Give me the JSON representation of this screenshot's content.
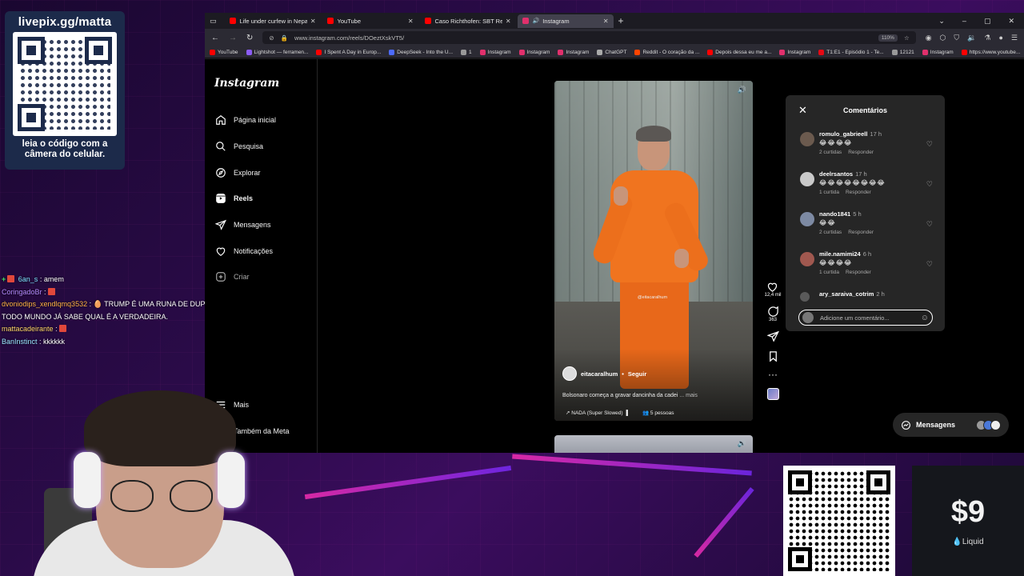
{
  "livepix": {
    "title": "livepix.gg/matta",
    "caption": "leia o código com a câmera do celular."
  },
  "chat": [
    {
      "user": "6an_s",
      "text": ": amem",
      "prefix": "+"
    },
    {
      "user": "CoringadoBr",
      "text": ":"
    },
    {
      "user": "dvoniodips_xendlqmq3532",
      "text": ": 🥚 TRUMP É UMA RUNA DE DUPLA ILUSÃO QUE",
      "cont": "TODO MUNDO JÁ SABE QUAL É A VERDADEIRA."
    },
    {
      "user": "mattacadeirante",
      "text": ":"
    },
    {
      "user": "BanInstinct",
      "text": ": kkkkkk"
    }
  ],
  "browser": {
    "tabs": [
      {
        "label": "Life under curfew in Nepal (Th",
        "color": "#ff0000"
      },
      {
        "label": "YouTube",
        "color": "#ff0000"
      },
      {
        "label": "Caso Richthofen: SBT Repórter",
        "color": "#ff0000"
      },
      {
        "label": "Instagram",
        "color": "#e1306c",
        "active": true
      }
    ],
    "url": "www.instagram.com/reels/DOeztXskVT5/",
    "zoom": "110%",
    "bookmarks": [
      {
        "label": "YouTube",
        "color": "#ff0000"
      },
      {
        "label": "Lightshot — ferramen...",
        "color": "#8b5cf6"
      },
      {
        "label": "I Spent A Day in Europ...",
        "color": "#ff0000"
      },
      {
        "label": "DeepSeek - Into the U...",
        "color": "#4d6bfe"
      },
      {
        "label": "1",
        "color": "#999999"
      },
      {
        "label": "Instagram",
        "color": "#e1306c"
      },
      {
        "label": "Instagram",
        "color": "#e1306c"
      },
      {
        "label": "Instagram",
        "color": "#e1306c"
      },
      {
        "label": "ChatGPT",
        "color": "#aaaaaa"
      },
      {
        "label": "Reddit - O coração da ...",
        "color": "#ff4500"
      },
      {
        "label": "Depois dessa eu me a...",
        "color": "#ff0000"
      },
      {
        "label": "Instagram",
        "color": "#e1306c"
      },
      {
        "label": "T1:E1 - Episódio 1 - Te...",
        "color": "#e50914"
      },
      {
        "label": "12121",
        "color": "#999999"
      },
      {
        "label": "Instagram",
        "color": "#e1306c"
      },
      {
        "label": "https://www.youtube...",
        "color": "#ff0000"
      }
    ]
  },
  "instagram": {
    "logo": "Instagram",
    "nav": [
      {
        "label": "Página inicial",
        "icon": "home-icon"
      },
      {
        "label": "Pesquisa",
        "icon": "search-icon"
      },
      {
        "label": "Explorar",
        "icon": "explore-icon"
      },
      {
        "label": "Reels",
        "icon": "reels-icon",
        "bold": true
      },
      {
        "label": "Mensagens",
        "icon": "messages-icon"
      },
      {
        "label": "Notificações",
        "icon": "heart-icon"
      },
      {
        "label": "Criar",
        "icon": "create-icon"
      }
    ],
    "more": "Mais",
    "meta": "Também da Meta",
    "reel": {
      "watermark": "@eitacaralhum",
      "author": "eitacaralhum",
      "follow": "Seguir",
      "caption": "Bolsonaro começa a gravar dancinha da cadei",
      "more": "... mais",
      "audio": "NADA (Super Slowed)",
      "people": "5 pessoas",
      "likes": "12,4 mil",
      "comments_count": "363"
    },
    "comments_panel": {
      "title": "Comentários",
      "input_placeholder": "Adicione um comentário...",
      "reply_label": "Responder",
      "items": [
        {
          "user": "romulo_gabrieell",
          "time": "17 h",
          "emoji": "😂😂😂😂",
          "likes": "2 curtidas"
        },
        {
          "user": "deelrsantos",
          "time": "17 h",
          "emoji": "😂😂😂😂😂😂😂😂",
          "likes": "1 curtida"
        },
        {
          "user": "nando1841",
          "time": "5 h",
          "emoji": "😂😂",
          "likes": "2 curtidas"
        },
        {
          "user": "mile.namimi24",
          "time": "6 h",
          "emoji": "😂😂😂😂",
          "likes": "1 curtida"
        },
        {
          "user": "ary_saraiva_cotrim",
          "time": "2 h"
        }
      ]
    },
    "messages_button": "Mensagens"
  },
  "donation": {
    "amount": "$9",
    "provider": "💧Liquid"
  }
}
